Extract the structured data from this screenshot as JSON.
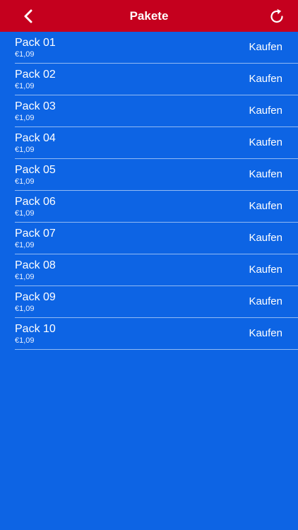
{
  "navbar": {
    "title": "Pakete",
    "back_icon": "chevron-left-icon",
    "reload_icon": "reload-icon",
    "background": "#c5001e"
  },
  "theme": {
    "list_background": "#0d64e4"
  },
  "packs": [
    {
      "name": "Pack 01",
      "price": "€1,09",
      "action": "Kaufen"
    },
    {
      "name": "Pack 02",
      "price": "€1,09",
      "action": "Kaufen"
    },
    {
      "name": "Pack 03",
      "price": "€1,09",
      "action": "Kaufen"
    },
    {
      "name": "Pack 04",
      "price": "€1,09",
      "action": "Kaufen"
    },
    {
      "name": "Pack 05",
      "price": "€1,09",
      "action": "Kaufen"
    },
    {
      "name": "Pack 06",
      "price": "€1,09",
      "action": "Kaufen"
    },
    {
      "name": "Pack 07",
      "price": "€1,09",
      "action": "Kaufen"
    },
    {
      "name": "Pack 08",
      "price": "€1,09",
      "action": "Kaufen"
    },
    {
      "name": "Pack 09",
      "price": "€1,09",
      "action": "Kaufen"
    },
    {
      "name": "Pack 10",
      "price": "€1,09",
      "action": "Kaufen"
    }
  ]
}
